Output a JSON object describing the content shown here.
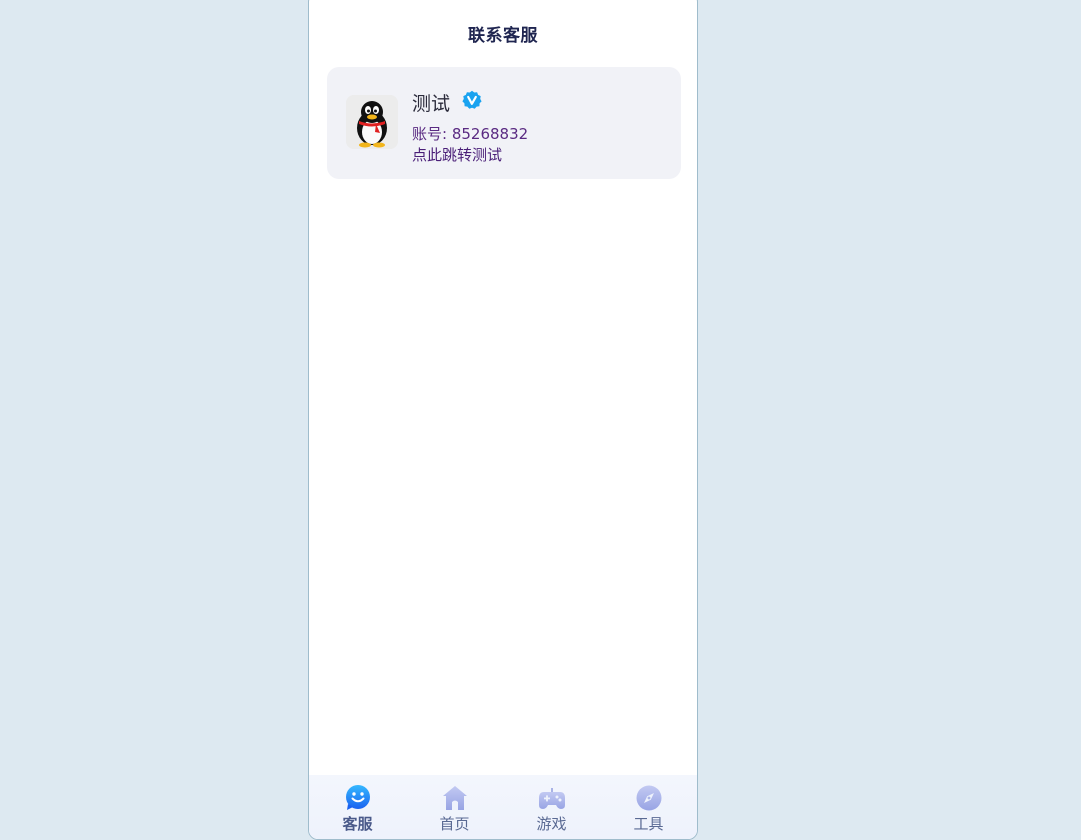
{
  "page": {
    "title": "联系客服"
  },
  "contact": {
    "name": "测试",
    "account": "账号: 85268832",
    "link_text": "点此跳转测试",
    "avatar_icon": "qq-penguin-icon",
    "badge_icon": "verified-badge-icon"
  },
  "tabbar": {
    "items": [
      {
        "label": "客服",
        "icon": "chat-smile-icon",
        "active": true
      },
      {
        "label": "首页",
        "icon": "home-icon",
        "active": false
      },
      {
        "label": "游戏",
        "icon": "gamepad-icon",
        "active": false
      },
      {
        "label": "工具",
        "icon": "compass-icon",
        "active": false
      }
    ]
  },
  "colors": {
    "background": "#dde9f1",
    "card": "#f1f2f7",
    "accent_blue": "#1a8cff",
    "tab_icon": "#a9b3e6",
    "text_purple": "#5a2a82"
  }
}
